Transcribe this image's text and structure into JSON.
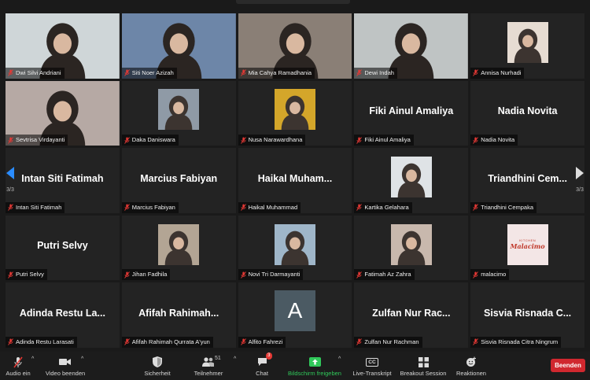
{
  "pager": {
    "left": "3/3",
    "right": "3/3"
  },
  "tiles": [
    {
      "name": "Dwi Silvi Andriani",
      "type": "video",
      "bg": "#cfd6d8"
    },
    {
      "name": "Siti Noer Azizah",
      "type": "video",
      "bg": "#6d86a8"
    },
    {
      "name": "Mia Cahya Ramadhania",
      "type": "video",
      "bg": "#8a7f76"
    },
    {
      "name": "Dewi Indah",
      "type": "video",
      "bg": "#bfc4c4"
    },
    {
      "name": "Annisa Nurhadi",
      "type": "photo",
      "bg": "#e6dcd2"
    },
    {
      "name": "Sevtrisa Virdayanti",
      "type": "video",
      "bg": "#b6a9a4"
    },
    {
      "name": "Daka Daniswara",
      "type": "photo",
      "bg": "#8f9aa6"
    },
    {
      "name": "Nusa Narawardhana",
      "type": "photo",
      "bg": "#d4a62a"
    },
    {
      "name": "Fiki Ainul Amaliya",
      "type": "text",
      "display": "Fiki Ainul Amaliya"
    },
    {
      "name": "Nadia Novita",
      "type": "text",
      "display": "Nadia Novita"
    },
    {
      "name": "Intan Siti Fatimah",
      "type": "text",
      "display": "Intan Siti Fatimah"
    },
    {
      "name": "Marcius Fabiyan",
      "type": "text",
      "display": "Marcius Fabiyan"
    },
    {
      "name": "Haikal Muhammad",
      "type": "text",
      "display": "Haikal Muham..."
    },
    {
      "name": "Kartika Gelahara",
      "type": "photo",
      "bg": "#dfe3e6"
    },
    {
      "name": "Triandhini Cempaka",
      "type": "text",
      "display": "Triandhini Cem..."
    },
    {
      "name": "Putri Selvy",
      "type": "text",
      "display": "Putri Selvy"
    },
    {
      "name": "Jihan Fadhila",
      "type": "photo",
      "bg": "#b3a594"
    },
    {
      "name": "Novi Tri Darmayanti",
      "type": "photo",
      "bg": "#9fb6c9"
    },
    {
      "name": "Fatimah Az Zahra",
      "type": "photo",
      "bg": "#c8b8ad"
    },
    {
      "name": "malacimo",
      "type": "logo",
      "bg": "#f3e6e6",
      "logo": "Malacimo",
      "logo_top": "KITCHEN"
    },
    {
      "name": "Adinda Restu Larasati",
      "type": "text",
      "display": "Adinda Restu La..."
    },
    {
      "name": "Afifah Rahimah Qurrata A'yun",
      "type": "text",
      "display": "Afifah Rahimah..."
    },
    {
      "name": "Alfito Fahrezi",
      "type": "letter",
      "display": "A"
    },
    {
      "name": "Zulfan Nur Rachman",
      "type": "text",
      "display": "Zulfan Nur Rac..."
    },
    {
      "name": "Sisvia Risnada Citra Ningrum",
      "type": "text",
      "display": "Sisvia Risnada C..."
    }
  ],
  "toolbar": {
    "audio": "Audio ein",
    "video": "Video beenden",
    "security": "Sicherheit",
    "participants": "Teilnehmer",
    "participants_count": "51",
    "chat": "Chat",
    "chat_badge": "3",
    "share": "Bildschirm freigeben",
    "transcript": "Live-Transkript",
    "transcript_icon": "CC",
    "breakout": "Breakout Session",
    "reactions": "Reaktionen",
    "end": "Beenden"
  },
  "colors": {
    "share_green": "#30c85a",
    "end_red": "#d0282f",
    "arrow_blue": "#2a8cff",
    "muted_red": "#e53935"
  }
}
